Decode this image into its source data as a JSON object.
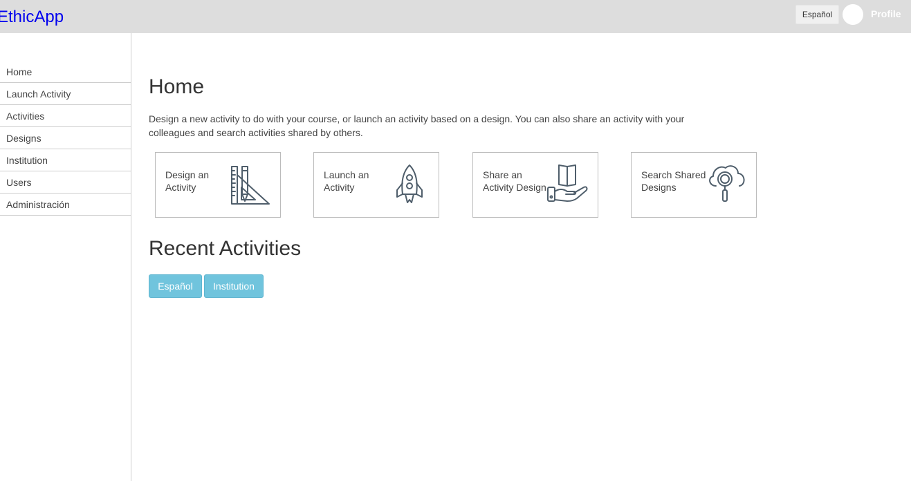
{
  "app": {
    "brand": "EthicApp"
  },
  "header": {
    "language_button": "Español",
    "profile_link": "Profile"
  },
  "sidebar": {
    "items": [
      {
        "label": "Home"
      },
      {
        "label": "Launch Activity"
      },
      {
        "label": "Activities"
      },
      {
        "label": "Designs"
      },
      {
        "label": "Institution"
      },
      {
        "label": "Users"
      },
      {
        "label": "Administración"
      }
    ]
  },
  "main": {
    "title": "Home",
    "intro": "Design a new activity to do with your course, or launch an activity based on a design. You can also share an activity with your colleagues and search activities shared by others.",
    "cards": [
      {
        "label": "Design an Activity",
        "icon": "design-tools-icon"
      },
      {
        "label": "Launch an Activity",
        "icon": "rocket-icon"
      },
      {
        "label": "Share an Activity Design",
        "icon": "share-book-hand-icon"
      },
      {
        "label": "Search Shared Designs",
        "icon": "cloud-search-icon"
      }
    ],
    "recent_title": "Recent Activities",
    "recent_buttons": [
      {
        "label": "Español"
      },
      {
        "label": "Institution"
      }
    ]
  },
  "colors": {
    "topbar": "#dddddd",
    "brand": "#0000ee",
    "tag_button": "#70c4dd",
    "icon_stroke": "#4f5e6b"
  }
}
